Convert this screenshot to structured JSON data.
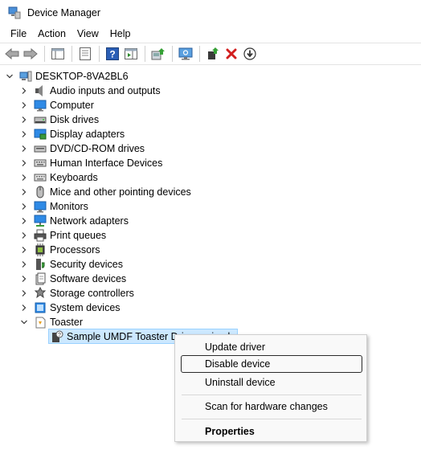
{
  "window": {
    "title": "Device Manager",
    "app_icon": "device-manager-icon"
  },
  "menubar": {
    "items": [
      "File",
      "Action",
      "View",
      "Help"
    ]
  },
  "toolbar": {
    "buttons": [
      {
        "icon": "back-arrow-icon"
      },
      {
        "icon": "forward-arrow-icon"
      },
      {
        "icon": "show-hide-console-tree-icon"
      },
      {
        "icon": "properties-icon"
      },
      {
        "icon": "help-icon"
      },
      {
        "icon": "action-pane-icon"
      },
      {
        "icon": "update-driver-icon"
      },
      {
        "icon": "scan-hardware-icon"
      },
      {
        "icon": "add-legacy-hardware-icon"
      },
      {
        "icon": "uninstall-device-icon"
      },
      {
        "icon": "disable-device-icon"
      }
    ]
  },
  "tree": {
    "root": "DESKTOP-8VA2BL6",
    "categories": [
      {
        "label": "Audio inputs and outputs",
        "icon": "speaker-icon"
      },
      {
        "label": "Computer",
        "icon": "computer-icon"
      },
      {
        "label": "Disk drives",
        "icon": "disk-drive-icon"
      },
      {
        "label": "Display adapters",
        "icon": "display-adapter-icon"
      },
      {
        "label": "DVD/CD-ROM drives",
        "icon": "dvd-drive-icon"
      },
      {
        "label": "Human Interface Devices",
        "icon": "hid-icon"
      },
      {
        "label": "Keyboards",
        "icon": "keyboard-icon"
      },
      {
        "label": "Mice and other pointing devices",
        "icon": "mouse-icon"
      },
      {
        "label": "Monitors",
        "icon": "monitor-icon"
      },
      {
        "label": "Network adapters",
        "icon": "network-adapter-icon"
      },
      {
        "label": "Print queues",
        "icon": "printer-icon"
      },
      {
        "label": "Processors",
        "icon": "processor-icon"
      },
      {
        "label": "Security devices",
        "icon": "security-device-icon"
      },
      {
        "label": "Software devices",
        "icon": "software-device-icon"
      },
      {
        "label": "Storage controllers",
        "icon": "storage-controller-icon"
      },
      {
        "label": "System devices",
        "icon": "system-devices-icon"
      },
      {
        "label": "Toaster",
        "icon": "toaster-icon"
      }
    ],
    "toaster_child": "Sample UMDF Toaster Driver - simple"
  },
  "context_menu": {
    "items": [
      "Update driver",
      "Disable device",
      "Uninstall device",
      "Scan for hardware changes",
      "Properties"
    ]
  }
}
